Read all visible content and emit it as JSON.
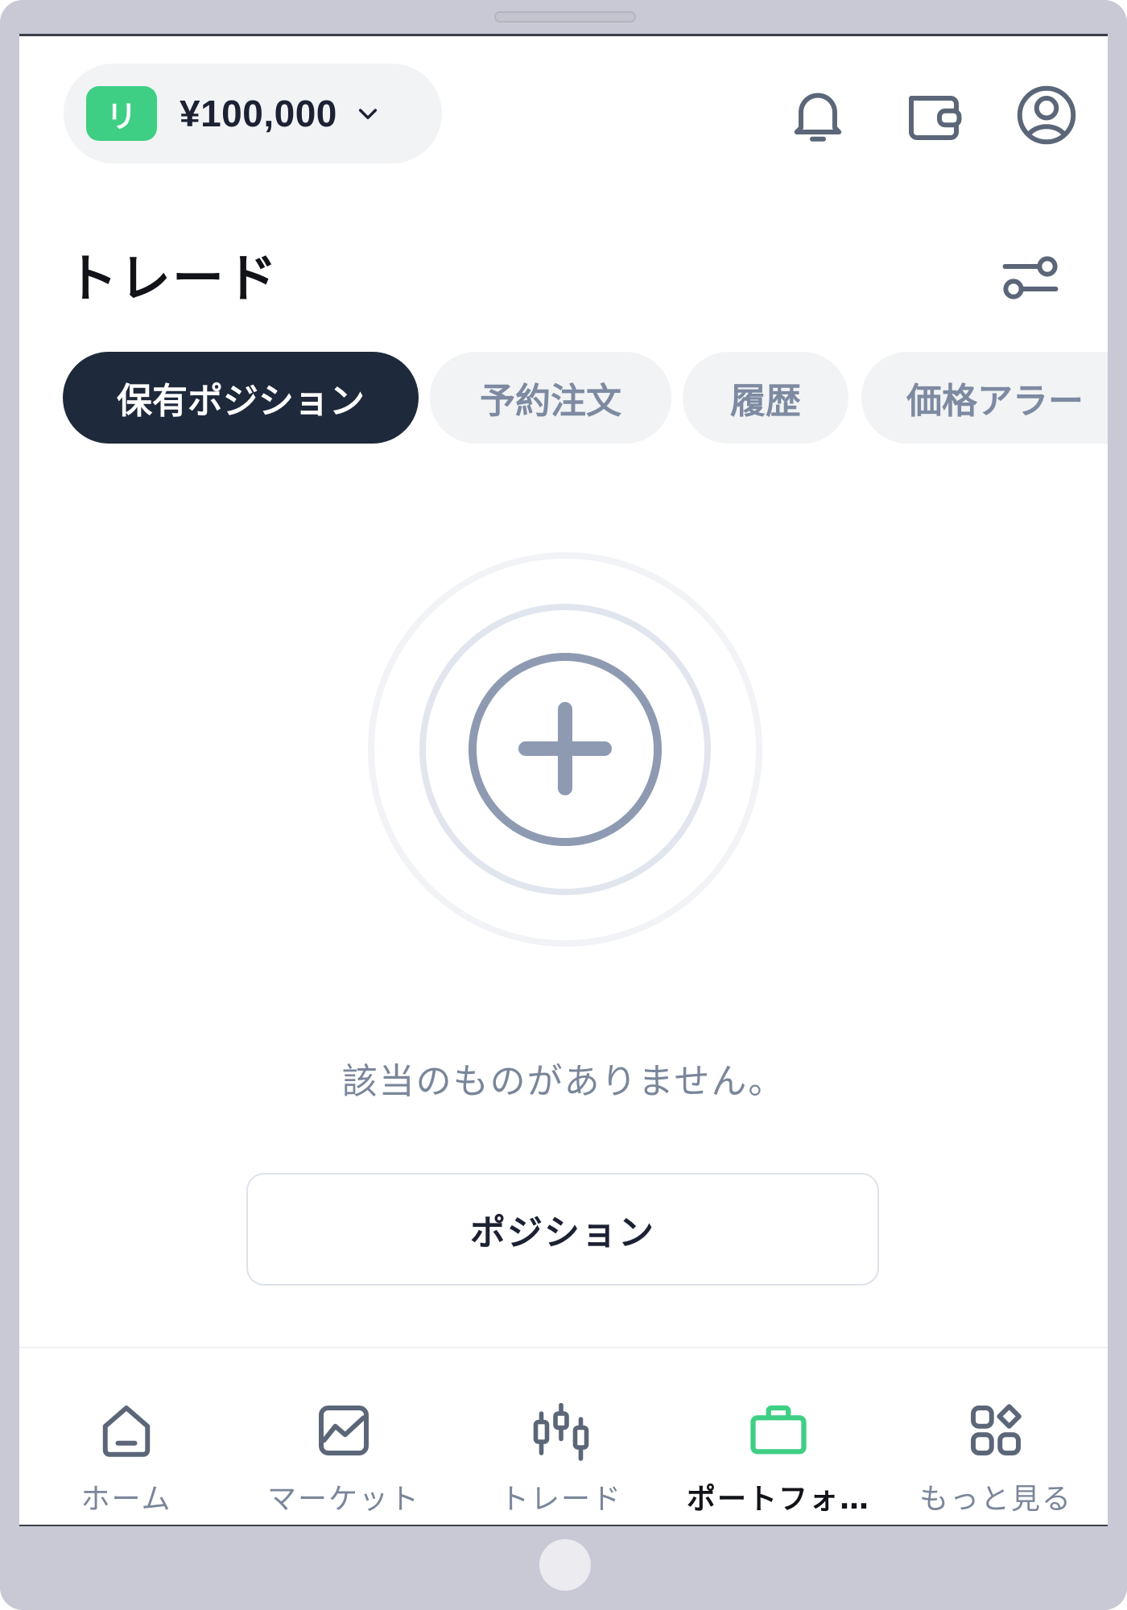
{
  "header": {
    "account_badge": "リ",
    "balance": "¥100,000"
  },
  "page": {
    "title": "トレード"
  },
  "tabs": [
    {
      "label": "保有ポジション",
      "active": true
    },
    {
      "label": "予約注文",
      "active": false
    },
    {
      "label": "履歴",
      "active": false
    },
    {
      "label": "価格アラー",
      "active": false
    }
  ],
  "empty_state": {
    "message": "該当のものがありません。",
    "button_label": "ポジション"
  },
  "bottom_nav": [
    {
      "label": "ホーム",
      "icon": "home-icon",
      "active": false
    },
    {
      "label": "マーケット",
      "icon": "market-chart-icon",
      "active": false
    },
    {
      "label": "トレード",
      "icon": "candlestick-icon",
      "active": false
    },
    {
      "label": "ポートフォ…",
      "icon": "briefcase-icon",
      "active": true
    },
    {
      "label": "もっと見る",
      "icon": "more-grid-icon",
      "active": false
    }
  ],
  "colors": {
    "accent_green": "#3fcf84",
    "active_tab": "#1e293b",
    "muted_text": "#7a869a",
    "icon_gray": "#5b6678"
  }
}
